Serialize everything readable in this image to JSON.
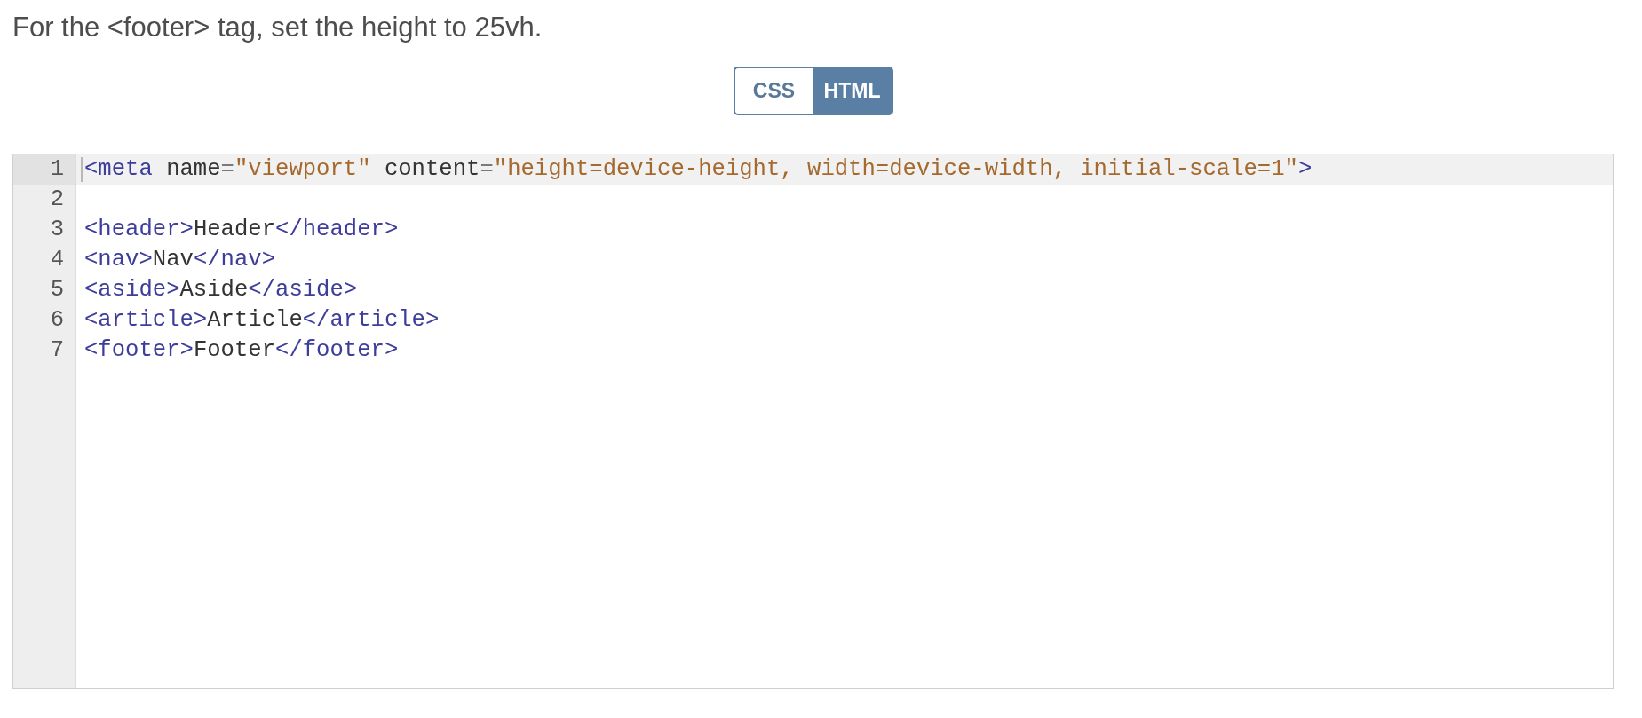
{
  "instruction": "For the <footer> tag, set the height to 25vh.",
  "language_tabs": [
    {
      "label": "CSS",
      "selected": false
    },
    {
      "label": "HTML",
      "selected": true
    }
  ],
  "editor": {
    "lines": [
      {
        "number": "1",
        "active": true,
        "tokens": [
          {
            "kind": "tag",
            "text": "<meta"
          },
          {
            "kind": "attribute",
            "text": " name"
          },
          {
            "kind": "operator",
            "text": "="
          },
          {
            "kind": "string",
            "text": "\"viewport\""
          },
          {
            "kind": "attribute",
            "text": " content"
          },
          {
            "kind": "operator",
            "text": "="
          },
          {
            "kind": "string",
            "text": "\"height=device-height, width=device-width, initial-scale=1\""
          },
          {
            "kind": "tag",
            "text": ">"
          }
        ]
      },
      {
        "number": "2",
        "active": false
      },
      {
        "number": "3",
        "active": false,
        "tokens": [
          {
            "kind": "tag",
            "text": "<header>"
          },
          {
            "kind": "text",
            "text": "Header"
          },
          {
            "kind": "tag",
            "text": "</header>"
          }
        ]
      },
      {
        "number": "4",
        "active": false,
        "tokens": [
          {
            "kind": "tag",
            "text": "<nav>"
          },
          {
            "kind": "text",
            "text": "Nav"
          },
          {
            "kind": "tag",
            "text": "</nav>"
          }
        ]
      },
      {
        "number": "5",
        "active": false,
        "tokens": [
          {
            "kind": "tag",
            "text": "<aside>"
          },
          {
            "kind": "text",
            "text": "Aside"
          },
          {
            "kind": "tag",
            "text": "</aside>"
          }
        ]
      },
      {
        "number": "6",
        "active": false,
        "tokens": [
          {
            "kind": "tag",
            "text": "<article>"
          },
          {
            "kind": "text",
            "text": "Article"
          },
          {
            "kind": "tag",
            "text": "</article>"
          }
        ]
      },
      {
        "number": "7",
        "active": false,
        "tokens": [
          {
            "kind": "tag",
            "text": "<footer>"
          },
          {
            "kind": "text",
            "text": "Footer"
          },
          {
            "kind": "tag",
            "text": "</footer>"
          }
        ]
      }
    ]
  }
}
